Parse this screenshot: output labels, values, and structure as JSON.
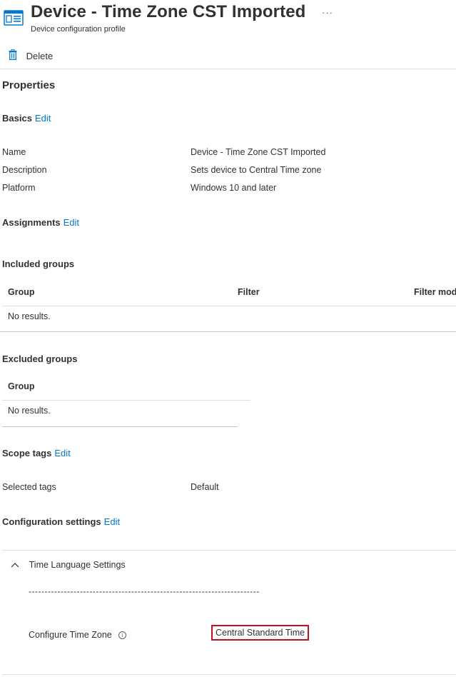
{
  "header": {
    "title": "Device - Time Zone CST Imported",
    "subtitle": "Device configuration profile",
    "more_label": "···",
    "icon": "device-profile-icon"
  },
  "toolbar": {
    "delete_label": "Delete",
    "delete_icon": "trash-icon"
  },
  "properties_heading": "Properties",
  "basics": {
    "title": "Basics",
    "edit": "Edit",
    "rows": [
      {
        "label": "Name",
        "value": "Device - Time Zone CST Imported"
      },
      {
        "label": "Description",
        "value": "Sets device to Central Time zone"
      },
      {
        "label": "Platform",
        "value": "Windows 10 and later"
      }
    ]
  },
  "assignments": {
    "title": "Assignments",
    "edit": "Edit",
    "included": {
      "title": "Included groups",
      "columns": [
        "Group",
        "Filter",
        "Filter mode"
      ],
      "empty": "No results."
    },
    "excluded": {
      "title": "Excluded groups",
      "columns": [
        "Group"
      ],
      "empty": "No results."
    }
  },
  "scope_tags": {
    "title": "Scope tags",
    "edit": "Edit",
    "label": "Selected tags",
    "value": "Default"
  },
  "configuration": {
    "title": "Configuration settings",
    "edit": "Edit",
    "group_title": "Time Language Settings",
    "separator": "------------------------------------------------------------------------",
    "setting_label": "Configure Time Zone",
    "setting_value": "Central Standard Time"
  },
  "colors": {
    "link": "#0078d4",
    "highlight_border": "#c50f1f",
    "icon": "#0078d4"
  }
}
